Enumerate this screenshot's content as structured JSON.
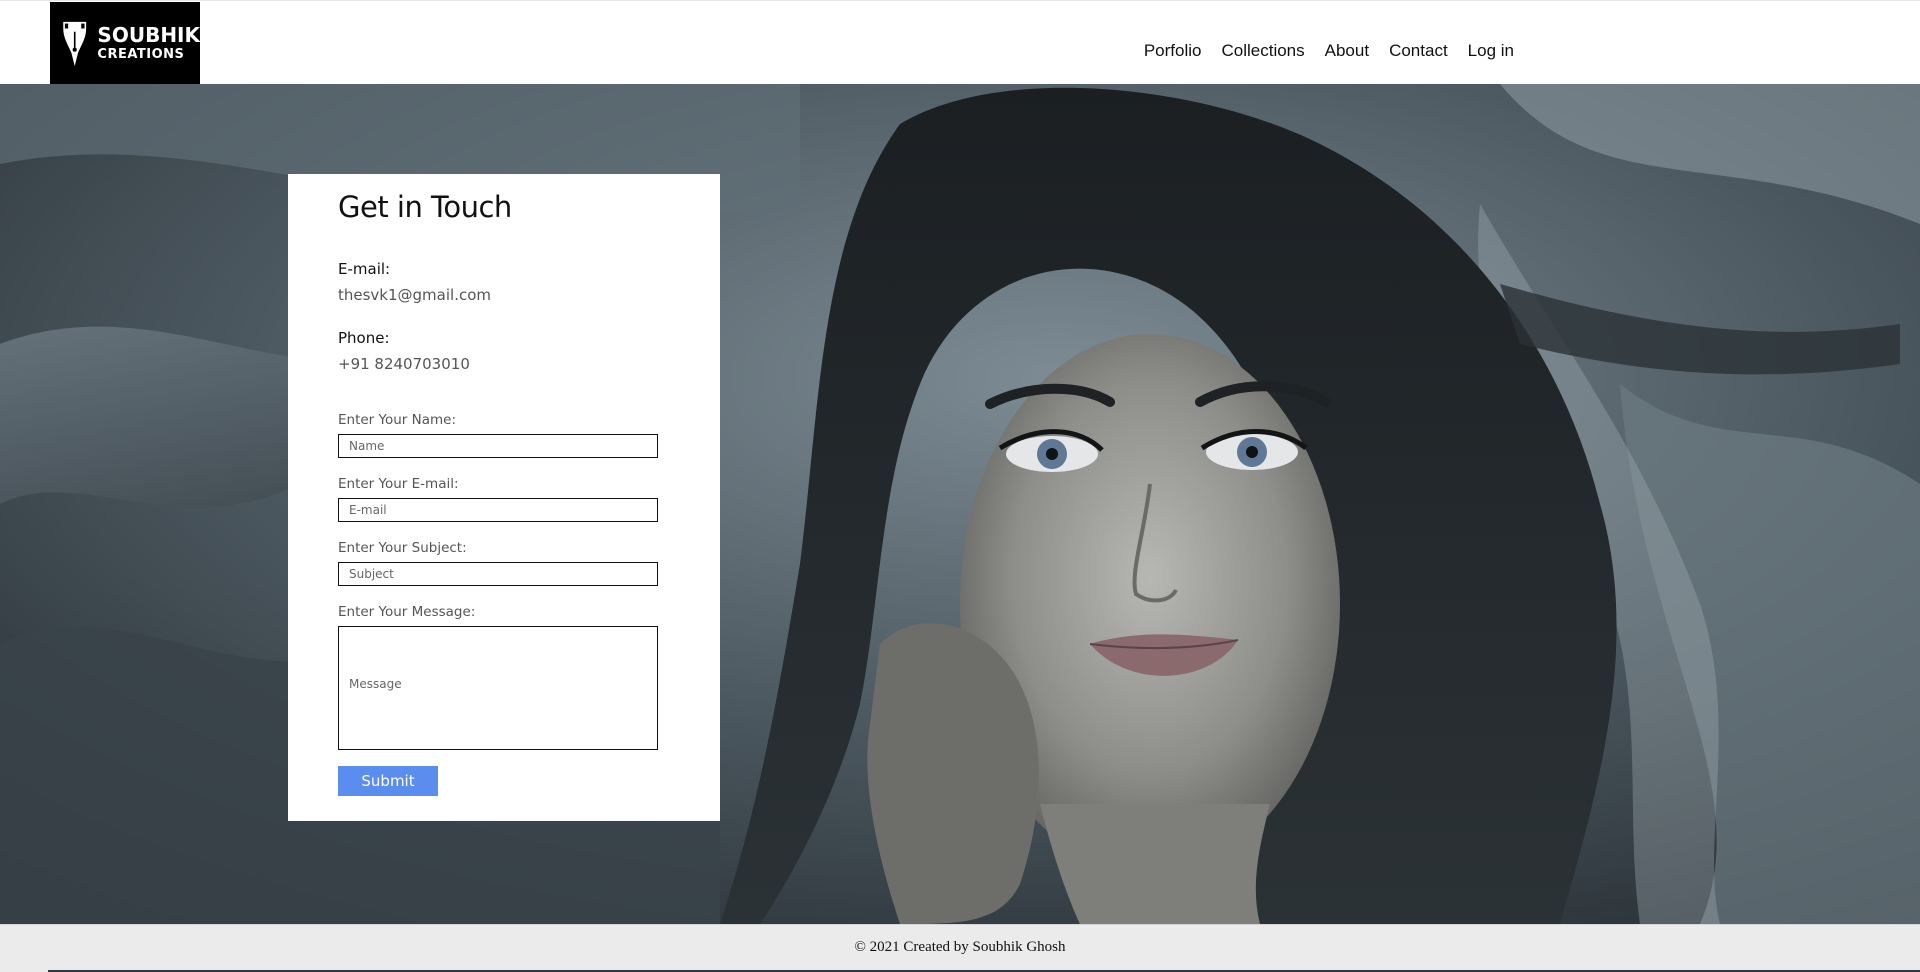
{
  "brand": {
    "name_line1": "SOUBHIK",
    "name_line2": "CREATIONS",
    "logo_icon": "pen-nib-icon"
  },
  "nav": {
    "items": [
      {
        "label": "Porfolio"
      },
      {
        "label": "Collections"
      },
      {
        "label": "About"
      },
      {
        "label": "Contact"
      },
      {
        "label": "Log in"
      }
    ]
  },
  "contact": {
    "title": "Get in Touch",
    "email_label": "E-mail:",
    "email_value": "thesvk1@gmail.com",
    "phone_label": "Phone:",
    "phone_value": "+91 8240703010"
  },
  "form": {
    "name_label": "Enter Your Name:",
    "name_placeholder": "Name",
    "email_label": "Enter Your E-mail:",
    "email_placeholder": "E-mail",
    "subject_label": "Enter Your Subject:",
    "subject_placeholder": "Subject",
    "message_label": "Enter Your Message:",
    "message_placeholder": "Message",
    "submit_label": "Submit"
  },
  "footer": {
    "text": "© 2021 Created by Soubhik Ghosh"
  },
  "colors": {
    "accent": "#5b8def",
    "header_bg": "#ffffff",
    "logo_bg": "#000000",
    "footer_bg": "#ebebeb"
  }
}
